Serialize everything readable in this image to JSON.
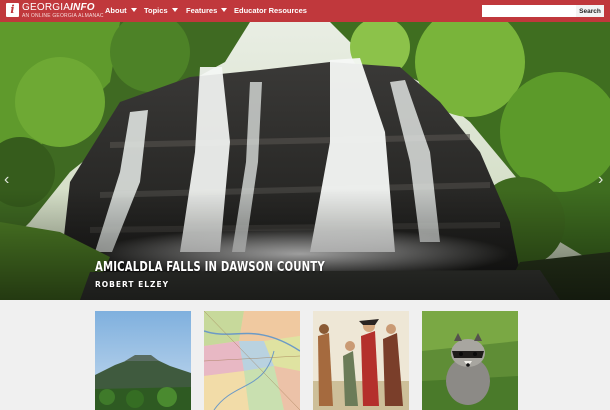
{
  "brand": {
    "name_regular": "GEORGIA",
    "name_bold": "INFO",
    "tagline": "AN ONLINE GEORGIA ALMANAC",
    "logo_icon": "info-i-icon",
    "accent": "#c0383c"
  },
  "nav": {
    "items": [
      {
        "label": "About",
        "has_dropdown": true
      },
      {
        "label": "Topics",
        "has_dropdown": true
      },
      {
        "label": "Features",
        "has_dropdown": true
      },
      {
        "label": "Educator Resources",
        "has_dropdown": false
      }
    ]
  },
  "search": {
    "value": "",
    "placeholder": "",
    "button_label": "Search"
  },
  "hero": {
    "title": "AMICALDLA FALLS IN DAWSON COUNTY",
    "credit": "ROBERT ELZEY",
    "prev_icon": "chevron-left-icon",
    "next_icon": "chevron-right-icon"
  },
  "cards": [
    {
      "subject": "mountain-photo"
    },
    {
      "subject": "historic-map"
    },
    {
      "subject": "historical-painting"
    },
    {
      "subject": "raccoon-photo"
    }
  ]
}
